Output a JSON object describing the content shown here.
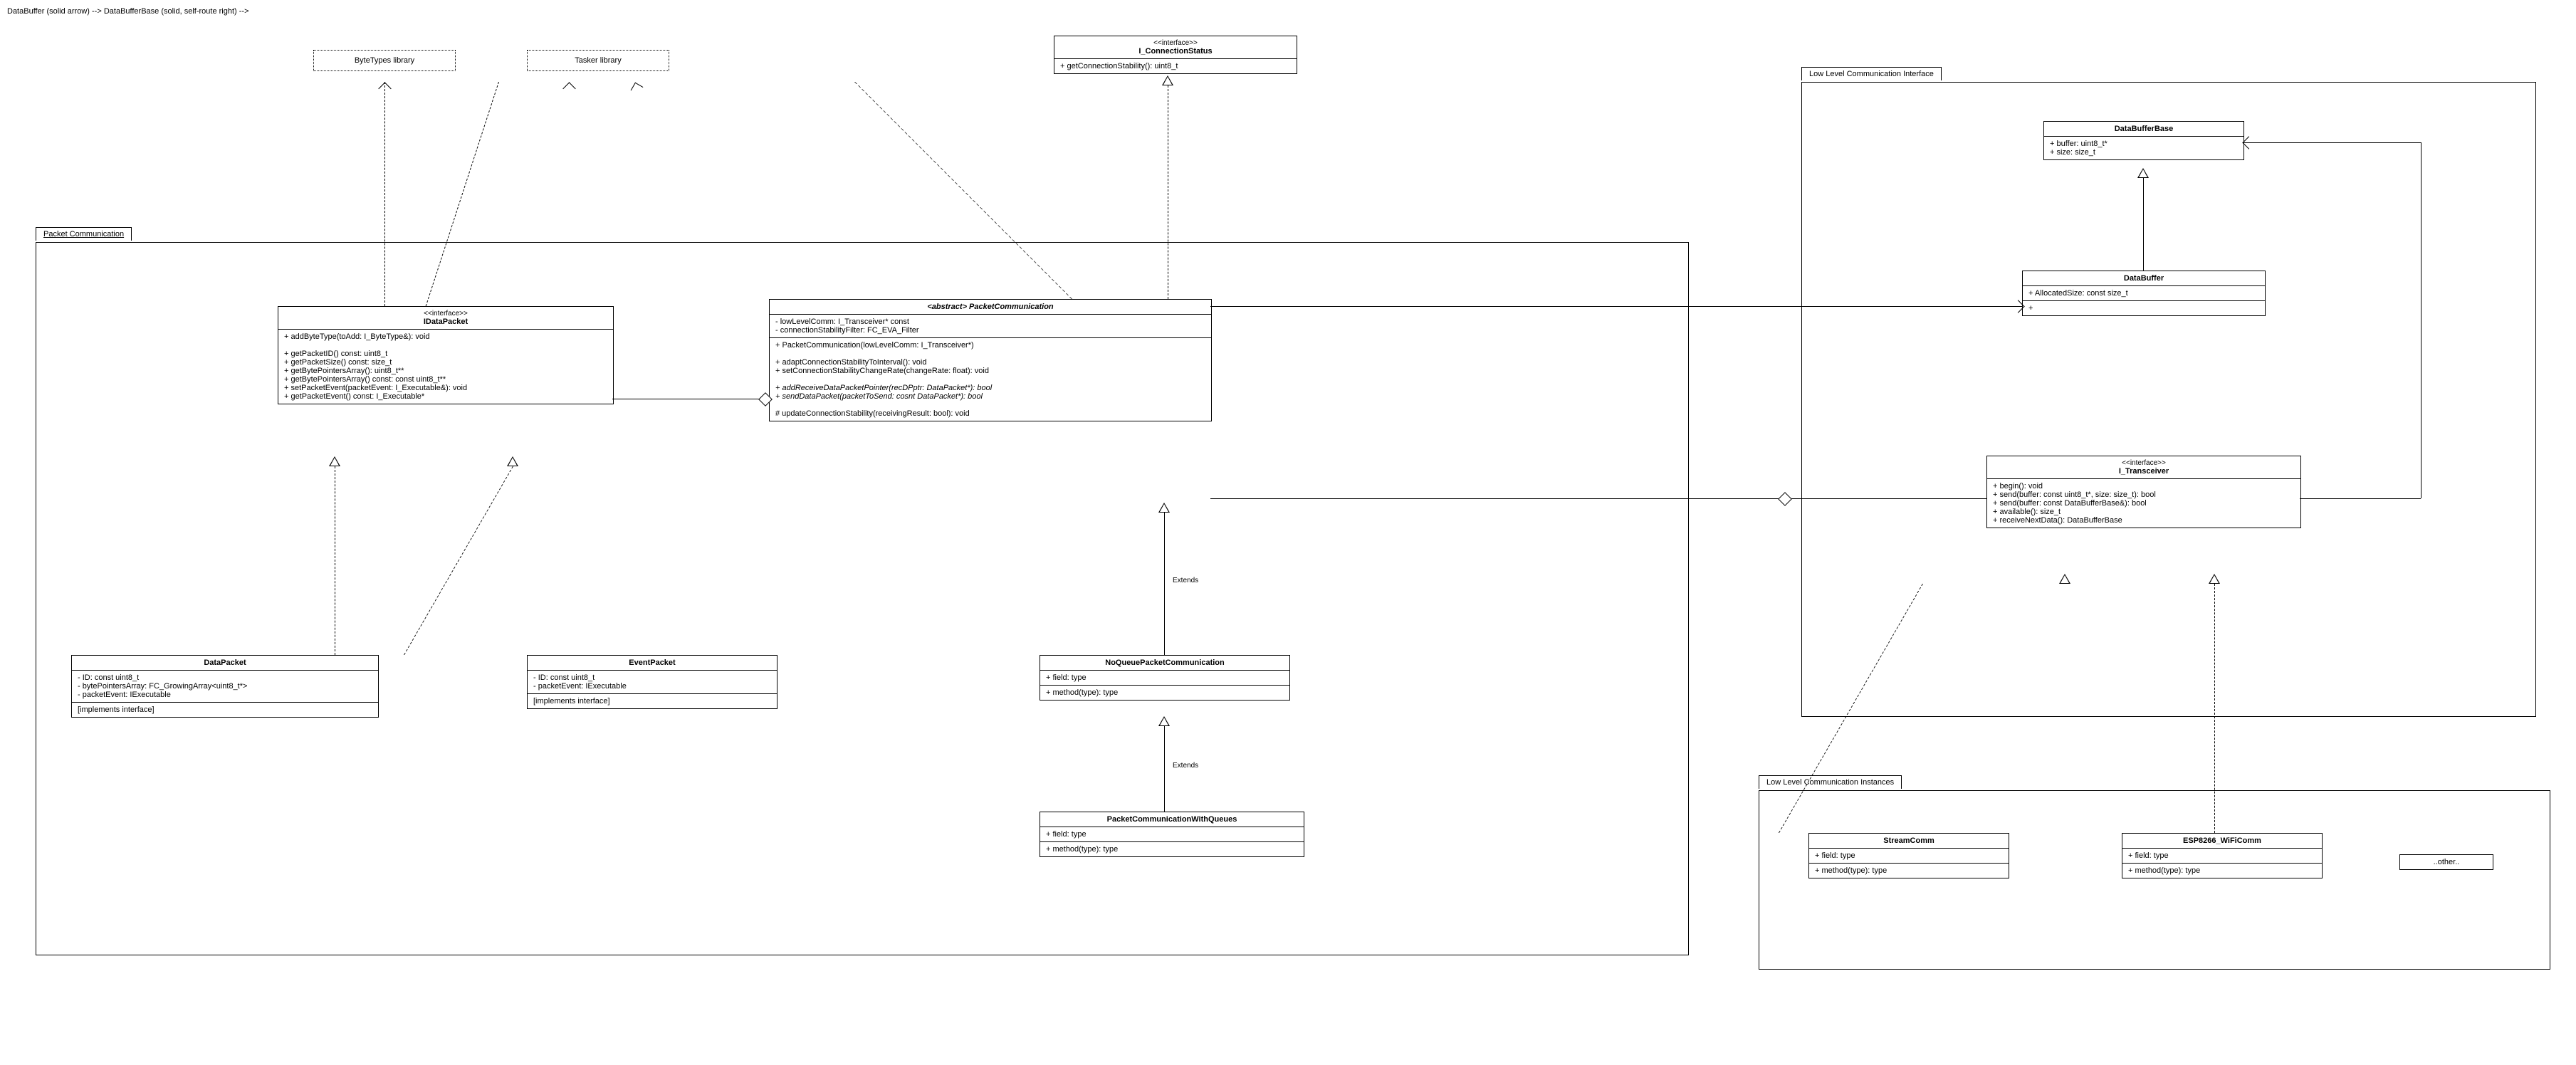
{
  "libs": {
    "byteTypes": "ByteTypes library",
    "tasker": "Tasker library"
  },
  "packages": {
    "packetComm": "Packet Communication",
    "lowLevelIface": "Low Level Communication Interface",
    "lowLevelInst": "Low Level Communication Instances"
  },
  "iConnStatus": {
    "stereo": "<<interface>>",
    "name": "I_ConnectionStatus",
    "op1": "+ getConnectionStability(): uint8_t"
  },
  "iDataPacket": {
    "stereo": "<<interface>>",
    "name": "IDataPacket",
    "ops": [
      "+ addByteType(toAdd: I_ByteType&): void",
      "",
      "+ getPacketID() const: uint8_t",
      "+ getPacketSize() const: size_t",
      "+ getBytePointersArray(): uint8_t**",
      "+ getBytePointersArray() const: const uint8_t**",
      "+ setPacketEvent(packetEvent: I_Executable&): void",
      "+ getPacketEvent() const: I_Executable*"
    ]
  },
  "packetComm": {
    "name": "<abstract> PacketCommunication",
    "attrs": [
      "- lowLevelComm: I_Transceiver* const",
      "- connectionStabilityFilter: FC_EVA_Filter"
    ],
    "ops": [
      "+ PacketCommunication(lowLevelComm: I_Transceiver*)",
      "",
      "+ adaptConnectionStabilityToInterval(): void",
      "+ setConnectionStabilityChangeRate(changeRate: float): void",
      "",
      "+ addReceiveDataPacketPointer(recDPptr: DataPacket*): bool",
      "+ sendDataPacket(packetToSend: cosnt DataPacket*): bool",
      "",
      "# updateConnectionStability(receivingResult: bool): void"
    ]
  },
  "dataPacket": {
    "name": "DataPacket",
    "attrs": [
      "- ID: const uint8_t",
      "- bytePointersArray: FC_GrowingArray<uint8_t*>",
      "- packetEvent: IExecutable"
    ],
    "note": "[implements interface]"
  },
  "eventPacket": {
    "name": "EventPacket",
    "attrs": [
      "- ID: const uint8_t",
      "- packetEvent: IExecutable"
    ],
    "note": "[implements interface]"
  },
  "noQueue": {
    "name": "NoQueuePacketCommunication",
    "attr": "+ field: type",
    "op": "+ method(type): type"
  },
  "withQueues": {
    "name": "PacketCommunicationWithQueues",
    "attr": "+ field: type",
    "op": "+ method(type): type"
  },
  "dataBufferBase": {
    "name": "DataBufferBase",
    "attrs": [
      "+ buffer: uint8_t*",
      "+ size: size_t"
    ]
  },
  "dataBuffer": {
    "name": "DataBuffer",
    "attr": "+ AllocatedSize: const size_t",
    "op": "+"
  },
  "iTransceiver": {
    "stereo": "<<interface>>",
    "name": "I_Transceiver",
    "ops": [
      "+ begin(): void",
      "+ send(buffer: const uint8_t*, size: size_t): bool",
      "+ send(buffer: const DataBufferBase&): bool",
      "+ available(): size_t",
      "+ receiveNextData(): DataBufferBase"
    ]
  },
  "streamComm": {
    "name": "StreamComm",
    "attr": "+ field: type",
    "op": "+ method(type): type"
  },
  "wifiComm": {
    "name": "ESP8266_WiFiComm",
    "attr": "+ field: type",
    "op": "+ method(type): type"
  },
  "other": "..other..",
  "extendsLabel": "Extends"
}
